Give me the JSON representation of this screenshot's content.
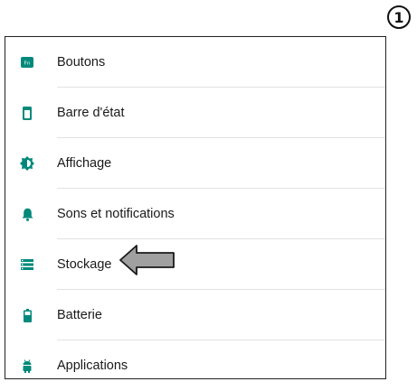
{
  "step_badge": "1",
  "accent_color": "#00897b",
  "menu": {
    "items": [
      {
        "label": "Boutons",
        "icon": "fn-key-icon"
      },
      {
        "label": "Barre d'état",
        "icon": "status-bar-icon"
      },
      {
        "label": "Affichage",
        "icon": "brightness-icon"
      },
      {
        "label": "Sons et notifications",
        "icon": "bell-icon"
      },
      {
        "label": "Stockage",
        "icon": "storage-icon"
      },
      {
        "label": "Batterie",
        "icon": "battery-icon"
      },
      {
        "label": "Applications",
        "icon": "android-icon"
      }
    ]
  },
  "fn_icon_text": "Fn"
}
